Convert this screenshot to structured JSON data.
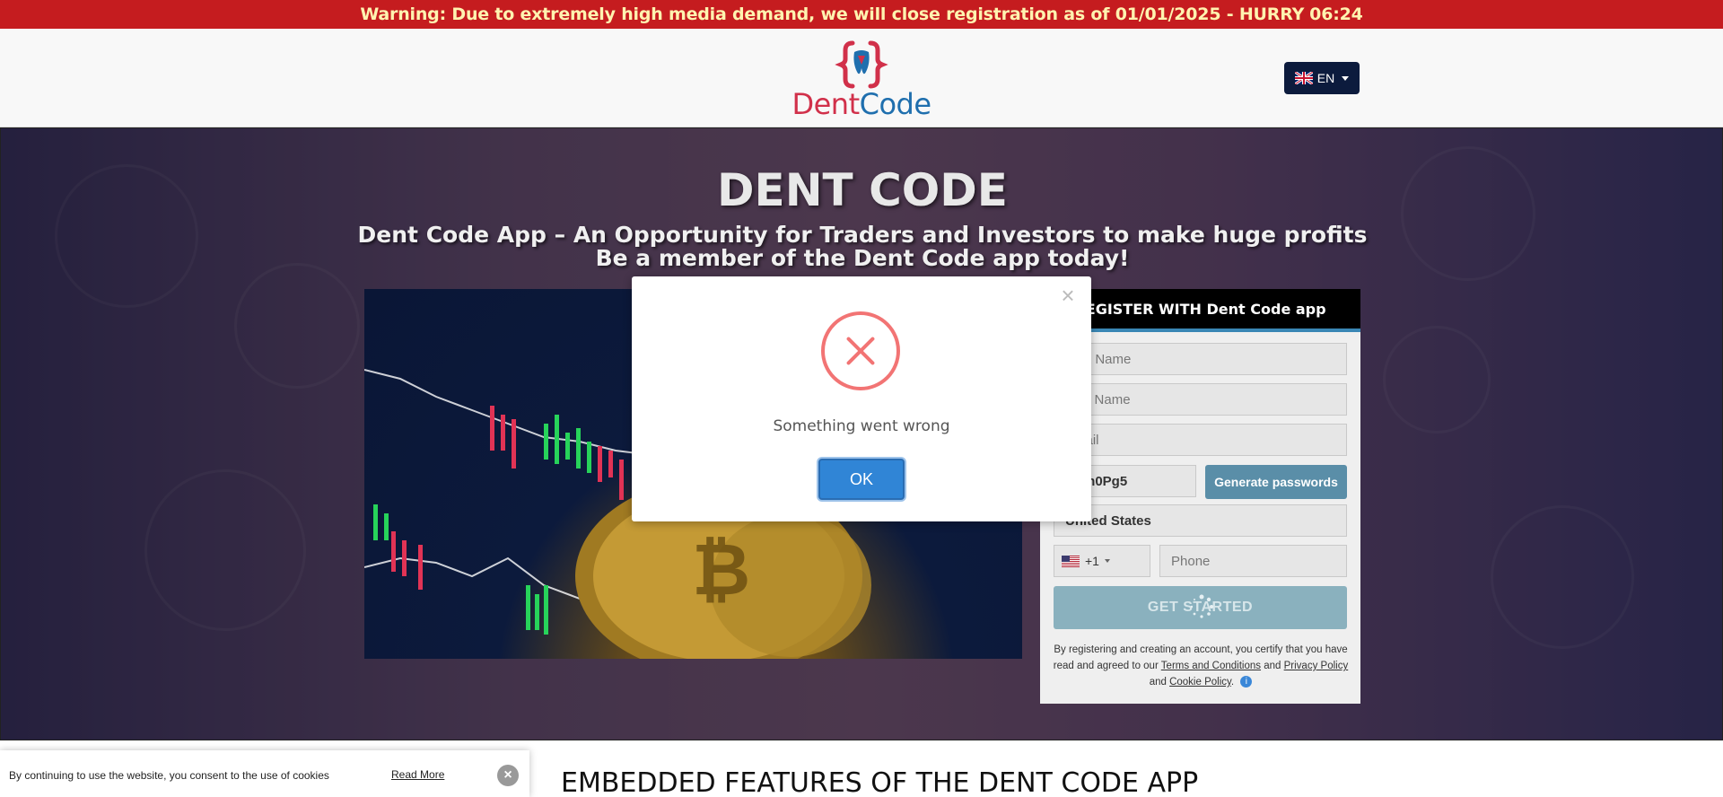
{
  "warning": {
    "text": "Warning: Due to extremely high media demand, we will close registration as of 01/01/2025 - HURRY",
    "timer": "06:24"
  },
  "header": {
    "logo_part1": "Dent",
    "logo_part2": "Code",
    "lang_label": "EN"
  },
  "hero": {
    "title": "DENT CODE",
    "subtitle_line1": "Dent Code App – An Opportunity for Traders and Investors to make huge profits",
    "subtitle_line2": "Be a member of the Dent Code app today!"
  },
  "form": {
    "header": "REGISTER WITH Dent Code app",
    "first_name_placeholder": "First Name",
    "last_name_placeholder": "Last Name",
    "email_placeholder": "Email",
    "password_value": "Udm0Pg5",
    "generate_label": "Generate passwords",
    "country_value": "United States",
    "country_code": "+1",
    "phone_placeholder": "Phone",
    "submit_label": "GET STARTED",
    "disclaimer_pre": "By registering and creating an account, you certify that you have read and agreed to our",
    "terms_link": "Terms and Conditions",
    "and1": "and",
    "privacy_link": "Privacy Policy",
    "and2": "and",
    "cookie_link": "Cookie Policy",
    "period": "."
  },
  "features": {
    "title": "EMBEDDED FEATURES OF THE DENT CODE APP"
  },
  "cookie": {
    "text": "By continuing to use the website, you consent to the use of cookies",
    "read_more": "Read More",
    "close": "×"
  },
  "modal": {
    "message": "Something went wrong",
    "ok_label": "OK",
    "close": "×"
  },
  "colors": {
    "warning_bg": "#c51c1f",
    "brand_red": "#d1304a",
    "brand_blue": "#1f6fae",
    "ok_button": "#3085d6",
    "error_icon": "#f27474"
  }
}
